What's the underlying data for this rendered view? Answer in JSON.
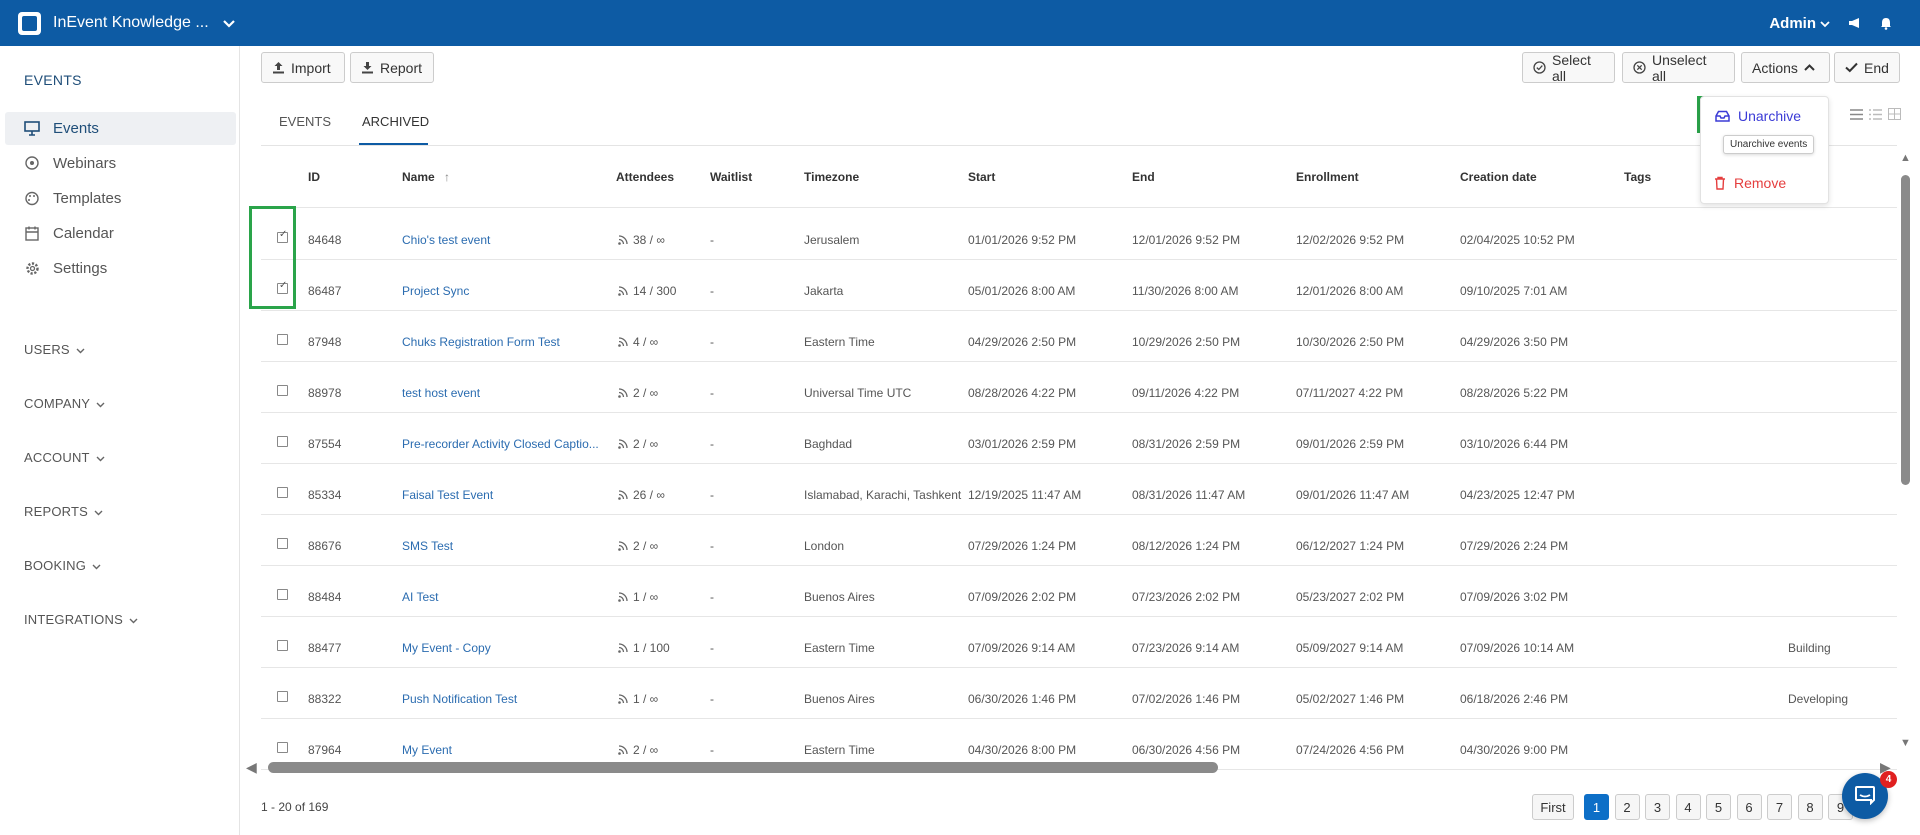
{
  "header": {
    "brand": "InEvent Knowledge ...",
    "user": "Admin"
  },
  "sidebar": {
    "title": "EVENTS",
    "items": [
      {
        "label": "Events",
        "icon": "presentation-icon"
      },
      {
        "label": "Webinars",
        "icon": "webinar-icon"
      },
      {
        "label": "Templates",
        "icon": "palette-icon"
      },
      {
        "label": "Calendar",
        "icon": "calendar-icon"
      },
      {
        "label": "Settings",
        "icon": "gear-icon"
      }
    ],
    "groups": [
      "USERS",
      "COMPANY",
      "ACCOUNT",
      "REPORTS",
      "BOOKING",
      "INTEGRATIONS"
    ]
  },
  "toolbar": {
    "import": "Import",
    "report": "Report",
    "select_all": "Select all",
    "unselect_all": "Unselect all",
    "actions": "Actions",
    "end": "End"
  },
  "tabs": [
    "EVENTS",
    "ARCHIVED"
  ],
  "dropdown": {
    "unarchive": "Unarchive",
    "tooltip": "Unarchive events",
    "remove": "Remove"
  },
  "table": {
    "columns": [
      "ID",
      "Name",
      "Attendees",
      "Waitlist",
      "Timezone",
      "Start",
      "End",
      "Enrollment",
      "Creation date",
      "Tags"
    ],
    "rows": [
      {
        "checked": true,
        "id": "84648",
        "name": "Chio's test event",
        "attendees": "38 / ∞",
        "waitlist": "-",
        "timezone": "Jerusalem",
        "start": "01/01/2026 9:52 PM",
        "end": "12/01/2026 9:52 PM",
        "enrollment": "12/02/2026 9:52 PM",
        "created": "02/04/2025 10:52 PM",
        "tags": ""
      },
      {
        "checked": true,
        "id": "86487",
        "name": "Project Sync",
        "attendees": "14 / 300",
        "waitlist": "-",
        "timezone": "Jakarta",
        "start": "05/01/2026 8:00 AM",
        "end": "11/30/2026 8:00 AM",
        "enrollment": "12/01/2026 8:00 AM",
        "created": "09/10/2025 7:01 AM",
        "tags": ""
      },
      {
        "checked": false,
        "id": "87948",
        "name": "Chuks Registration Form Test",
        "attendees": "4 / ∞",
        "waitlist": "-",
        "timezone": "Eastern Time",
        "start": "04/29/2026 2:50 PM",
        "end": "10/29/2026 2:50 PM",
        "enrollment": "10/30/2026 2:50 PM",
        "created": "04/29/2026 3:50 PM",
        "tags": ""
      },
      {
        "checked": false,
        "id": "88978",
        "name": "test host event",
        "attendees": "2 / ∞",
        "waitlist": "-",
        "timezone": "Universal Time UTC",
        "start": "08/28/2026 4:22 PM",
        "end": "09/11/2026 4:22 PM",
        "enrollment": "07/11/2027 4:22 PM",
        "created": "08/28/2026 5:22 PM",
        "tags": ""
      },
      {
        "checked": false,
        "id": "87554",
        "name": "Pre-recorder Activity Closed Captio...",
        "attendees": "2 / ∞",
        "waitlist": "-",
        "timezone": "Baghdad",
        "start": "03/01/2026 2:59 PM",
        "end": "08/31/2026 2:59 PM",
        "enrollment": "09/01/2026 2:59 PM",
        "created": "03/10/2026 6:44 PM",
        "tags": ""
      },
      {
        "checked": false,
        "id": "85334",
        "name": "Faisal Test Event",
        "attendees": "26 / ∞",
        "waitlist": "-",
        "timezone": "Islamabad, Karachi, Tashkent",
        "start": "12/19/2025 11:47 AM",
        "end": "08/31/2026 11:47 AM",
        "enrollment": "09/01/2026 11:47 AM",
        "created": "04/23/2025 12:47 PM",
        "tags": ""
      },
      {
        "checked": false,
        "id": "88676",
        "name": "SMS Test",
        "attendees": "2 / ∞",
        "waitlist": "-",
        "timezone": "London",
        "start": "07/29/2026 1:24 PM",
        "end": "08/12/2026 1:24 PM",
        "enrollment": "06/12/2027 1:24 PM",
        "created": "07/29/2026 2:24 PM",
        "tags": ""
      },
      {
        "checked": false,
        "id": "88484",
        "name": "AI Test",
        "attendees": "1 / ∞",
        "waitlist": "-",
        "timezone": "Buenos Aires",
        "start": "07/09/2026 2:02 PM",
        "end": "07/23/2026 2:02 PM",
        "enrollment": "05/23/2027 2:02 PM",
        "created": "07/09/2026 3:02 PM",
        "tags": ""
      },
      {
        "checked": false,
        "id": "88477",
        "name": "My Event - Copy",
        "attendees": "1 / 100",
        "waitlist": "-",
        "timezone": "Eastern Time",
        "start": "07/09/2026 9:14 AM",
        "end": "07/23/2026 9:14 AM",
        "enrollment": "05/09/2027 9:14 AM",
        "created": "07/09/2026 10:14 AM",
        "tags": "Building"
      },
      {
        "checked": false,
        "id": "88322",
        "name": "Push Notification Test",
        "attendees": "1 / ∞",
        "waitlist": "-",
        "timezone": "Buenos Aires",
        "start": "06/30/2026 1:46 PM",
        "end": "07/02/2026 1:46 PM",
        "enrollment": "05/02/2027 1:46 PM",
        "created": "06/18/2026 2:46 PM",
        "tags": "Developing"
      },
      {
        "checked": false,
        "id": "87964",
        "name": "My Event",
        "attendees": "2 / ∞",
        "waitlist": "-",
        "timezone": "Eastern Time",
        "start": "04/30/2026 8:00 PM",
        "end": "06/30/2026 4:56 PM",
        "enrollment": "07/24/2026 4:56 PM",
        "created": "04/30/2026 9:00 PM",
        "tags": ""
      }
    ]
  },
  "footer": {
    "range": "1 - 20 of 169",
    "first": "First",
    "pages": [
      "1",
      "2",
      "3",
      "4",
      "5",
      "6",
      "7",
      "8",
      "9"
    ],
    "current_page": "1",
    "chat_badge": "4"
  },
  "colors": {
    "header": "#0d5ba4",
    "link": "#2b6cb0",
    "highlight": "#2aa44a",
    "danger": "#e53e3e",
    "unarchive": "#3b3bd6"
  }
}
